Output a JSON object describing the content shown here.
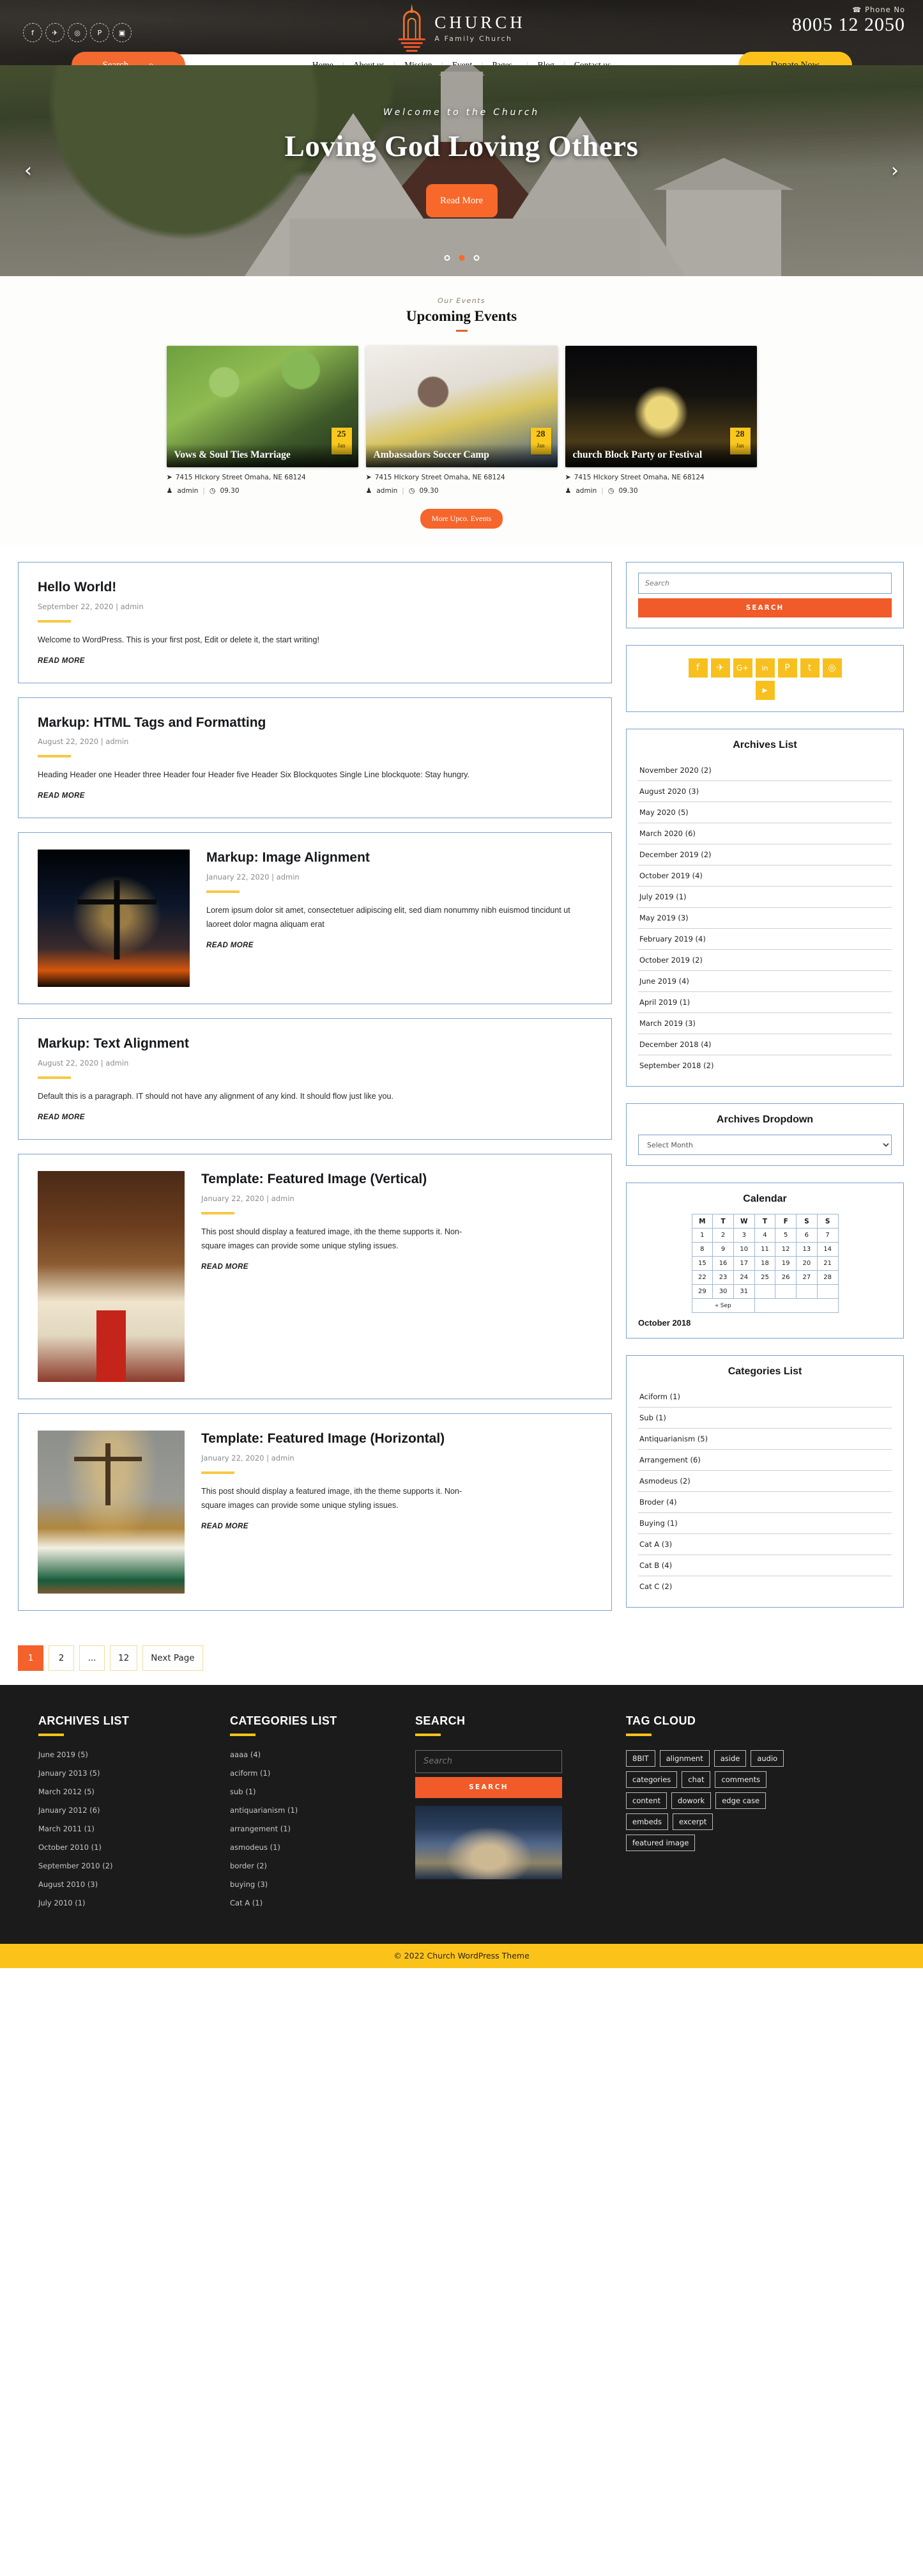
{
  "header": {
    "social_top": [
      {
        "name": "facebook-icon",
        "glyph": "f"
      },
      {
        "name": "twitter-icon",
        "glyph": "✈"
      },
      {
        "name": "instagram-icon",
        "glyph": "◎"
      },
      {
        "name": "pinterest-icon",
        "glyph": "P"
      },
      {
        "name": "youtube-icon",
        "glyph": "▣"
      }
    ],
    "brand_title": "CHURCH",
    "brand_sub": "A Family Church",
    "phone_label": "Phone No",
    "phone_icon": "☎",
    "phone_number": "8005 12 2050",
    "search_label": "Search ...",
    "search_icon": "⌕",
    "donate_label": "Donate Now",
    "nav": [
      "Home",
      "About us",
      "Mission",
      "Event",
      "Pages",
      "Blog",
      "Contact us"
    ],
    "nav_dropdown_marker": "⌄"
  },
  "hero": {
    "kicker": "Welcome to the Church",
    "title": "Loving God Loving Others",
    "button": "Read More",
    "prev_icon": "‹",
    "next_icon": "›",
    "dots": 3,
    "active_dot": 1
  },
  "events": {
    "kicker": "Our Events",
    "title": "Upcoming Events",
    "more_button": "More Upco. Events",
    "location_icon": "➤",
    "author_icon": "♟",
    "time_icon": "◷",
    "cards": [
      {
        "title": "Vows & Soul Ties Marriage",
        "day": "25",
        "month": "Jan",
        "address": "7415 HIckory Street Omaha, NE 68124",
        "author": "admin",
        "time": "09.30"
      },
      {
        "title": "Ambassadors Soccer Camp",
        "day": "28",
        "month": "Jan",
        "address": "7415 HIckory Street Omaha, NE 68124",
        "author": "admin",
        "time": "09.30"
      },
      {
        "title": "church Block Party or Festival",
        "day": "28",
        "month": "Jan",
        "address": "7415 HIckory Street Omaha, NE 68124",
        "author": "admin",
        "time": "09.30"
      }
    ]
  },
  "posts": [
    {
      "title": "Hello World!",
      "meta": "September 22, 2020 | admin",
      "body": "Welcome to WordPress. This is your first post, Edit or delete it, the start writing!",
      "read_more": "READ MORE",
      "layout": "text"
    },
    {
      "title": "Markup: HTML Tags and Formatting",
      "meta": "August 22, 2020 | admin",
      "body": "Heading Header one Header three Header four Header five Header Six Blockquotes Single Line blockquote: Stay hungry.",
      "read_more": "READ MORE",
      "layout": "text"
    },
    {
      "title": "Markup: Image Alignment",
      "meta": "January 22, 2020 | admin",
      "body": "Lorem ipsum dolor sit amet, consectetuer adipiscing elit, sed diam nonummy nibh euismod tincidunt ut laoreet dolor magna aliquam erat",
      "read_more": "READ MORE",
      "layout": "image-left",
      "image": "cross-silhouette-image"
    },
    {
      "title": "Markup: Text Alignment",
      "meta": "August 22, 2020 | admin",
      "body": "Default this is a paragraph. IT should not have any alignment of any kind. It should flow just like you.",
      "read_more": "READ MORE",
      "layout": "text"
    },
    {
      "title": "Template: Featured Image (Vertical)",
      "meta": "January 22, 2020 | admin",
      "body": "This post should display a featured image, ith the theme supports it. Non-square images can provide some unique styling issues.",
      "read_more": "READ MORE",
      "layout": "image-left",
      "image": "church-nave-image"
    },
    {
      "title": "Template: Featured Image (Horizontal)",
      "meta": "January 22, 2020 | admin",
      "body": "This post should display a featured image, ith the theme supports it. Non-square images can provide some unique styling issues.",
      "read_more": "READ MORE",
      "layout": "image-left",
      "image": "altar-bible-image"
    }
  ],
  "pagination": {
    "pages": [
      "1",
      "2",
      "...",
      "12",
      "Next Page"
    ],
    "active": "1"
  },
  "sidebar": {
    "search": {
      "placeholder": "Search",
      "button": "SEARCH"
    },
    "social": [
      {
        "name": "facebook-icon",
        "glyph": "f"
      },
      {
        "name": "twitter-icon",
        "glyph": "✈"
      },
      {
        "name": "google-plus-icon",
        "glyph": "G"
      },
      {
        "name": "linkedin-icon",
        "glyph": "in"
      },
      {
        "name": "pinterest-icon",
        "glyph": "P"
      },
      {
        "name": "tumblr-icon",
        "glyph": "t"
      },
      {
        "name": "instagram-icon",
        "glyph": "◎"
      },
      {
        "name": "youtube-icon",
        "glyph": "▶"
      }
    ],
    "archives_title": "Archives List",
    "archives": [
      "November 2020 (2)",
      "August 2020 (3)",
      "May 2020 (5)",
      "March 2020 (6)",
      "December 2019 (2)",
      "October 2019 (4)",
      "July 2019 (1)",
      "May 2019 (3)",
      "February 2019 (4)",
      "October 2019 (2)",
      "June 2019 (4)",
      "April 2019 (1)",
      "March 2019 (3)",
      "December 2018 (4)",
      "September 2018 (2)"
    ],
    "archives_dropdown_title": "Archives Dropdown",
    "archives_dropdown_value": "Select Month",
    "calendar_title": "Calendar",
    "calendar": {
      "weekdays": [
        "M",
        "T",
        "W",
        "T",
        "F",
        "S",
        "S"
      ],
      "weeks": [
        [
          "1",
          "2",
          "3",
          "4",
          "5",
          "6",
          "7"
        ],
        [
          "8",
          "9",
          "10",
          "11",
          "12",
          "13",
          "14"
        ],
        [
          "15",
          "16",
          "17",
          "18",
          "19",
          "20",
          "21"
        ],
        [
          "22",
          "23",
          "24",
          "25",
          "26",
          "27",
          "28"
        ],
        [
          "29",
          "30",
          "31",
          "",
          "",
          "",
          ""
        ]
      ],
      "prev_label": "« Sep",
      "caption": "October 2018"
    },
    "categories_title": "Categories List",
    "categories": [
      "Aciform (1)",
      "Sub (1)",
      "Antiquarianism (5)",
      "Arrangement (6)",
      "Asmodeus (2)",
      "Broder (4)",
      "Buying (1)",
      "Cat A (3)",
      "Cat B (4)",
      "Cat C (2)"
    ]
  },
  "footer": {
    "archives_title": "ARCHIVES LIST",
    "archives": [
      "June 2019 (5)",
      "January  2013 (5)",
      "March 2012 (5)",
      "January  2012 (6)",
      "March  2011 (1)",
      "October 2010 (1)",
      "September 2010 (2)",
      "August 2010 (3)",
      "July 2010 (1)"
    ],
    "categories_title": "CATEGORIES LIST",
    "categories": [
      "aaaa (4)",
      "aciform (1)",
      "sub (1)",
      "antiquarianism (1)",
      "arrangement (1)",
      "asmodeus (1)",
      "border (2)",
      "buying (3)",
      "Cat A (1)"
    ],
    "search_title": "SEARCH",
    "search_placeholder": "Search",
    "search_button": "SEARCH",
    "tagcloud_title": "TAG CLOUD",
    "tags": [
      "8BIT",
      "alignment",
      "aside",
      "audio",
      "categories",
      "chat",
      "comments",
      "content",
      "dowork",
      "edge case",
      "embeds",
      "excerpt",
      "featured image"
    ],
    "copyright": "© 2022 Church WordPress Theme"
  },
  "colors": {
    "orange": "#f15a29",
    "yellow": "#fbc31a",
    "dark": "#1b1b1b",
    "border_blue": "#7ba2cb"
  }
}
